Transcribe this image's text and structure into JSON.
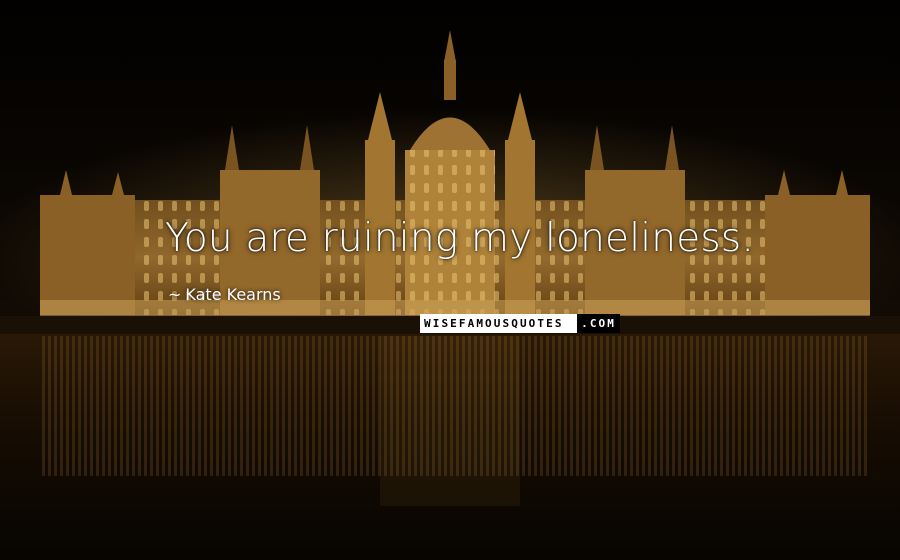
{
  "quote": {
    "text": "You are ruining my loneliness."
  },
  "author": {
    "dash": "~",
    "name": "Kate Kearns"
  },
  "watermark": {
    "left": "WISEFAMOUSQUOTES",
    "right": ".COM"
  },
  "colors": {
    "sky": "#050301",
    "building_glow": "#b88a3a",
    "building_dark": "#3a2608",
    "water": "#1a0f04",
    "text": "#ffffff"
  },
  "background": {
    "subject": "illuminated-parliament-building-at-night"
  }
}
